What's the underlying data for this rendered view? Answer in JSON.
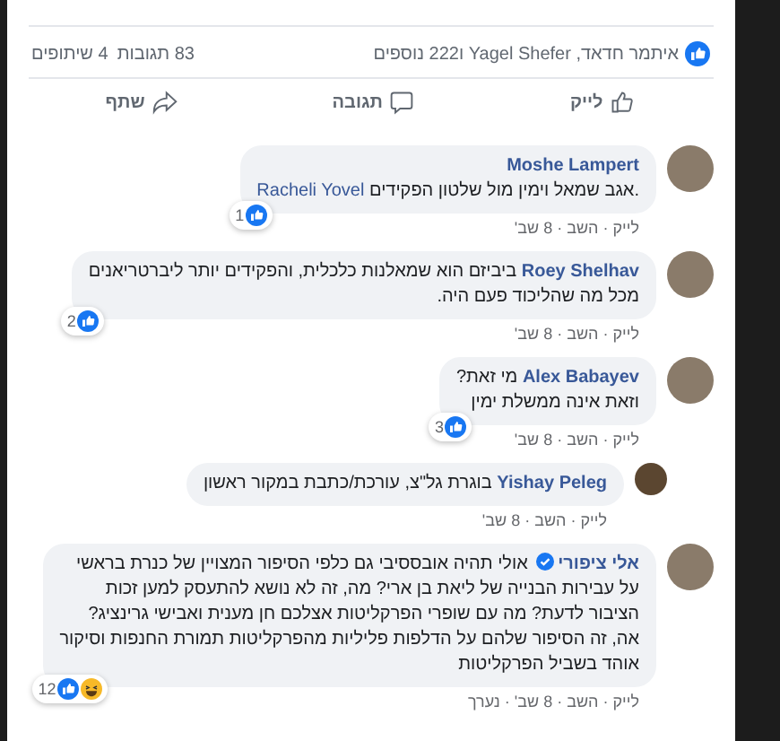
{
  "summary": {
    "likers": "איתמר חדאד, Yagel Shefer ו222 נוספים",
    "comments_count": "83 תגובות",
    "shares_count": "4 שיתופים"
  },
  "actions": [
    {
      "kind": "like",
      "label": "לייק"
    },
    {
      "kind": "comment",
      "label": "תגובה"
    },
    {
      "kind": "share",
      "label": "שתף"
    }
  ],
  "comments": [
    {
      "author": "Moshe Lampert",
      "kind": "stacked",
      "verified": false,
      "lines": [
        ".אגב שמאל וימין מול שלטון הפקידים"
      ],
      "tag": "Racheli Yovel",
      "reactions": {
        "count": "1",
        "icons": [
          {
            "kind": "like"
          }
        ]
      },
      "meta": "לייק · השב · 8 שב'"
    },
    {
      "author": "Roey Shelhav",
      "kind": "inline",
      "verified": false,
      "lines": [
        "ביביזם הוא שמאלנות כלכלית, והפקידים יותר ליברטריאנים",
        "מכל מה שהליכוד פעם היה."
      ],
      "reactions": {
        "count": "2",
        "icons": [
          {
            "kind": "like"
          }
        ]
      },
      "meta": "לייק · השב · 8 שב'"
    },
    {
      "author": "Alex Babayev",
      "kind": "inline",
      "verified": false,
      "lines": [
        "מי זאת?",
        "וזאת אינה ממשלת ימין"
      ],
      "reactions": {
        "count": "3",
        "icons": [
          {
            "kind": "like"
          }
        ]
      },
      "meta": "לייק · השב · 8 שב'"
    },
    {
      "author": "Yishay Peleg",
      "kind": "reply",
      "verified": false,
      "lines": [
        "בוגרת גל\"צ, עורכת/כתבת במקור ראשון"
      ],
      "meta": "לייק · השב · 8 שב'"
    },
    {
      "author": "אלי ציפורי",
      "kind": "inline",
      "verified": true,
      "lines": [
        "אולי תהיה אובססיבי גם כלפי הסיפור המצויין של כנרת בראשי",
        "על עבירות הבנייה של ליאת בן ארי? מה, זה לא נושא להתעסק למען זכות",
        "הציבור לדעת? מה עם שופרי הפרקליטות אצלכם חן מענית ואבישי גרינציג?",
        "אה, זה הסיפור שלהם על הדלפות פליליות מהפרקליטות תמורת החנפות וסיקור",
        "אוהד בשביל הפרקליטות"
      ],
      "reactions": {
        "count": "12",
        "icons": [
          {
            "kind": "like"
          },
          {
            "kind": "haha"
          }
        ]
      },
      "meta": "לייק · השב · 8 שב' · נערך"
    }
  ]
}
